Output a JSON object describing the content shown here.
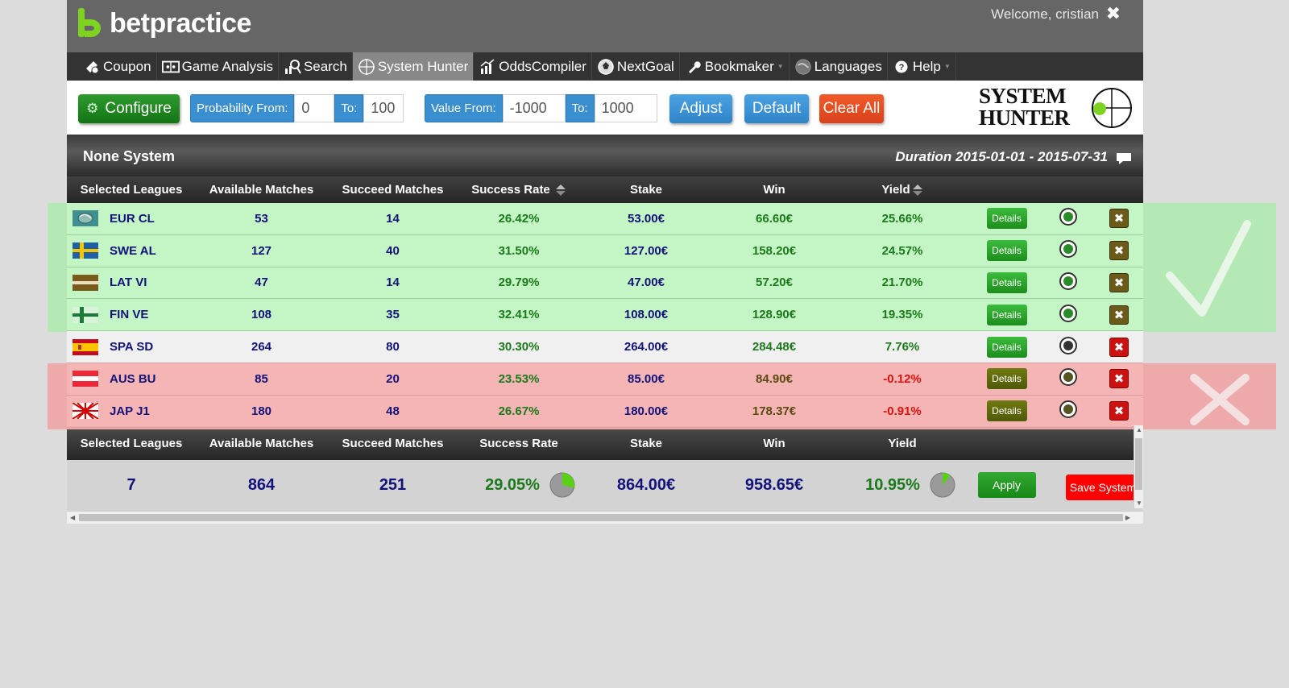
{
  "app": {
    "logo_text": "betpractice",
    "welcome": "Welcome, cristian",
    "close_glyph": "✖"
  },
  "nav": [
    {
      "id": "coupon",
      "label": "Coupon",
      "icon": "coupon-icon",
      "active": false,
      "caret": false
    },
    {
      "id": "game-analysis",
      "label": "Game Analysis",
      "icon": "game-analysis-icon",
      "active": false,
      "caret": false
    },
    {
      "id": "search",
      "label": "Search",
      "icon": "search-icon",
      "active": false,
      "caret": false
    },
    {
      "id": "system-hunter",
      "label": "System Hunter",
      "icon": "crosshair-icon",
      "active": true,
      "caret": false
    },
    {
      "id": "odds-compiler",
      "label": "OddsCompiler",
      "icon": "chart-icon",
      "active": false,
      "caret": false
    },
    {
      "id": "next-goal",
      "label": "NextGoal",
      "icon": "goal-icon",
      "active": false,
      "caret": false
    },
    {
      "id": "bookmaker",
      "label": "Bookmaker",
      "icon": "wrench-icon",
      "active": false,
      "caret": true
    },
    {
      "id": "languages",
      "label": "Languages",
      "icon": "globe-icon",
      "active": false,
      "caret": false
    },
    {
      "id": "help",
      "label": "Help",
      "icon": "help-icon",
      "active": false,
      "caret": true
    }
  ],
  "toolbar": {
    "configure_label": "Configure",
    "prob_from_label": "Probability From:",
    "prob_from_value": "0",
    "prob_to_label": "To:",
    "prob_to_value": "100",
    "value_from_label": "Value From:",
    "value_from_value": "-1000",
    "value_to_label": "To:",
    "value_to_value": "1000",
    "adjust_label": "Adjust",
    "default_label": "Default",
    "clear_label": "Clear All",
    "logo_line1": "SYSTEM",
    "logo_line2": "HUNTER"
  },
  "panel": {
    "system_name": "None System",
    "duration": "Duration 2015-01-01 - 2015-07-31"
  },
  "columns": {
    "league": "Selected Leagues",
    "available": "Available Matches",
    "succeed": "Succeed Matches",
    "rate": "Success Rate",
    "stake": "Stake",
    "win": "Win",
    "yield": "Yield"
  },
  "details_label": "Details",
  "rows": [
    {
      "league": "EUR CL",
      "flag": "eur",
      "available": "53",
      "succeed": "14",
      "rate": "26.42%",
      "stake": "53.00€",
      "win": "66.60€",
      "yield": "25.66%",
      "status": "g"
    },
    {
      "league": "SWE AL",
      "flag": "swe",
      "available": "127",
      "succeed": "40",
      "rate": "31.50%",
      "stake": "127.00€",
      "win": "158.20€",
      "yield": "24.57%",
      "status": "g"
    },
    {
      "league": "LAT VI",
      "flag": "lat",
      "available": "47",
      "succeed": "14",
      "rate": "29.79%",
      "stake": "47.00€",
      "win": "57.20€",
      "yield": "21.70%",
      "status": "g"
    },
    {
      "league": "FIN VE",
      "flag": "fin",
      "available": "108",
      "succeed": "35",
      "rate": "32.41%",
      "stake": "108.00€",
      "win": "128.90€",
      "yield": "19.35%",
      "status": "g"
    },
    {
      "league": "SPA SD",
      "flag": "spa",
      "available": "264",
      "succeed": "80",
      "rate": "30.30%",
      "stake": "264.00€",
      "win": "284.48€",
      "yield": "7.76%",
      "status": "n"
    },
    {
      "league": "AUS BU",
      "flag": "aus",
      "available": "85",
      "succeed": "20",
      "rate": "23.53%",
      "stake": "85.00€",
      "win": "84.90€",
      "yield": "-0.12%",
      "status": "r"
    },
    {
      "league": "JAP J1",
      "flag": "jap",
      "available": "180",
      "succeed": "48",
      "rate": "26.67%",
      "stake": "180.00€",
      "win": "178.37€",
      "yield": "-0.91%",
      "status": "r"
    }
  ],
  "summary": {
    "leagues": "7",
    "available": "864",
    "succeed": "251",
    "rate": "29.05%",
    "stake": "864.00€",
    "win": "958.65€",
    "yield": "10.95%",
    "rate_pie_fraction": 0.2905,
    "yield_pie_fraction": 0.1095,
    "apply_label": "Apply",
    "save_label": "Save System"
  },
  "colors": {
    "good_band": "#b4e8b4",
    "bad_band": "#eeaaaa",
    "accent_blue": "#3a8fd0",
    "accent_green": "#1d8e1d",
    "accent_red": "#e0421a"
  }
}
